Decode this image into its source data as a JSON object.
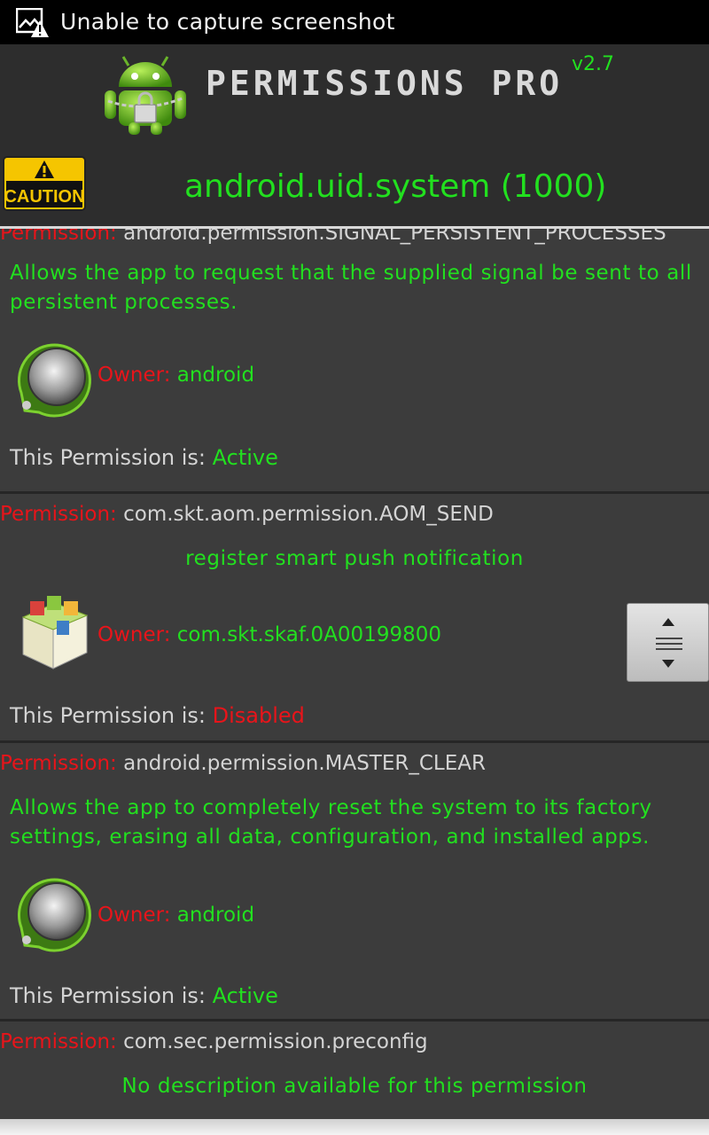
{
  "status_bar": {
    "text": "Unable to capture screenshot",
    "icon": "screenshot-warning-icon"
  },
  "header": {
    "app_title": "PERMISSIONS PRO",
    "version": "v2.7",
    "caution_label": "CAUTION",
    "uid": "android.uid.system (1000)"
  },
  "permissions": [
    {
      "label": "Permission:",
      "name": "android.permission.SIGNAL_PERSISTENT_PROCESSES",
      "description": "Allows the app to request that the supplied signal be sent to all persistent processes.",
      "owner_label": "Owner:",
      "owner": "android",
      "owner_icon": "android-system-icon",
      "status_label": "This Permission is:",
      "status": "Active"
    },
    {
      "label": "Permission:",
      "name": "com.skt.aom.permission.AOM_SEND",
      "description": "register smart push notification",
      "owner_label": "Owner:",
      "owner": "com.skt.skaf.0A00199800",
      "owner_icon": "app-box-icon",
      "status_label": "This Permission is:",
      "status": "Disabled"
    },
    {
      "label": "Permission:",
      "name": "android.permission.MASTER_CLEAR",
      "description": "Allows the app to completely reset the system to its factory settings, erasing all data, configuration, and installed apps.",
      "owner_label": "Owner:",
      "owner": "android",
      "owner_icon": "android-system-icon",
      "status_label": "This Permission is:",
      "status": "Active"
    },
    {
      "label": "Permission:",
      "name": "com.sec.permission.preconfig",
      "description": "No description available for this permission"
    }
  ],
  "colors": {
    "accent_green": "#22e01f",
    "label_red": "#e8141a",
    "background": "#3c3c3c"
  }
}
